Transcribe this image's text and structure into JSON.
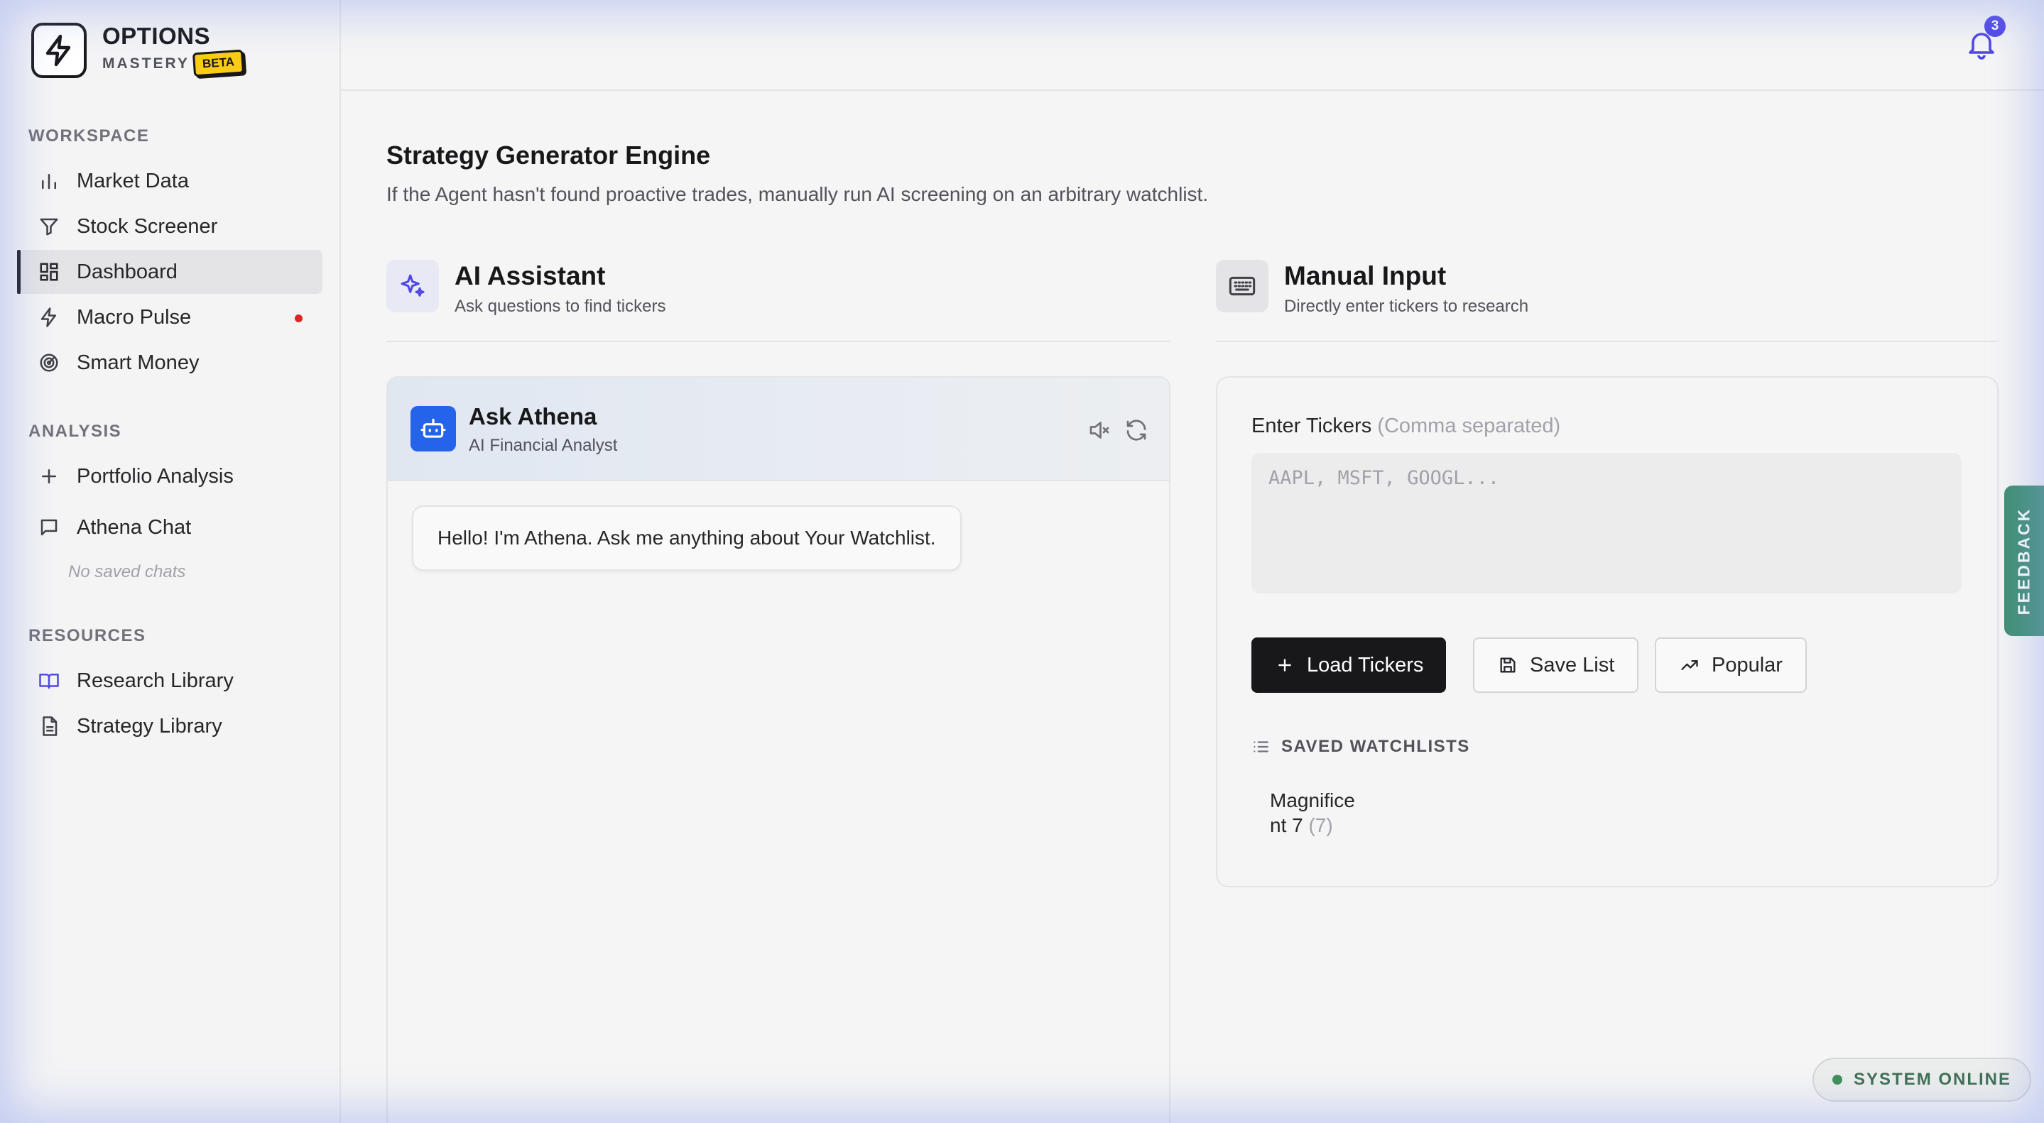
{
  "brand": {
    "name": "OPTIONS",
    "sub": "MASTERY",
    "badge": "BETA"
  },
  "sidebar": {
    "workspace_label": "WORKSPACE",
    "workspace_items": [
      {
        "label": "Market Data",
        "icon": "bar-chart-icon"
      },
      {
        "label": "Stock Screener",
        "icon": "filter-icon"
      },
      {
        "label": "Dashboard",
        "icon": "grid-icon",
        "active": true
      },
      {
        "label": "Macro Pulse",
        "icon": "lightning-icon",
        "indicator": "#dc2626"
      },
      {
        "label": "Smart Money",
        "icon": "radar-icon"
      }
    ],
    "analysis_label": "ANALYSIS",
    "analysis_items": [
      {
        "label": "Portfolio Analysis",
        "icon": "plus-icon"
      },
      {
        "label": "Athena Chat",
        "icon": "chat-icon"
      }
    ],
    "no_saved_chats": "No saved chats",
    "resources_label": "RESOURCES",
    "resources_items": [
      {
        "label": "Research Library",
        "icon": "book-icon"
      },
      {
        "label": "Strategy Library",
        "icon": "document-icon"
      }
    ]
  },
  "header": {
    "notification_count": "3"
  },
  "main": {
    "title": "Strategy Generator Engine",
    "description": "If the Agent hasn't found proactive trades, manually run AI screening on an arbitrary watchlist.",
    "ai_panel": {
      "title": "AI Assistant",
      "subtitle": "Ask questions to find tickers"
    },
    "manual_panel": {
      "title": "Manual Input",
      "subtitle": "Directly enter tickers to research"
    },
    "chat": {
      "title": "Ask Athena",
      "subtitle": "AI Financial Analyst",
      "greeting": "Hello! I'm Athena. Ask me anything about Your Watchlist."
    },
    "manual": {
      "field_label": "Enter Tickers",
      "field_hint": "(Comma separated)",
      "placeholder": "AAPL, MSFT, GOOGL...",
      "value": "",
      "load_label": "Load Tickers",
      "save_label": "Save List",
      "popular_label": "Popular",
      "saved_label": "SAVED WATCHLISTS",
      "watchlists": [
        {
          "name": "Magnificent 7",
          "count": "(7)"
        }
      ]
    }
  },
  "feedback_label": "FEEDBACK",
  "status": {
    "label": "SYSTEM ONLINE"
  },
  "colors": {
    "accent": "#4f46e5",
    "brand_blue": "#2563eb",
    "feedback": "#3f8f72",
    "alert": "#dc2626",
    "online": "#3f8f5a"
  }
}
